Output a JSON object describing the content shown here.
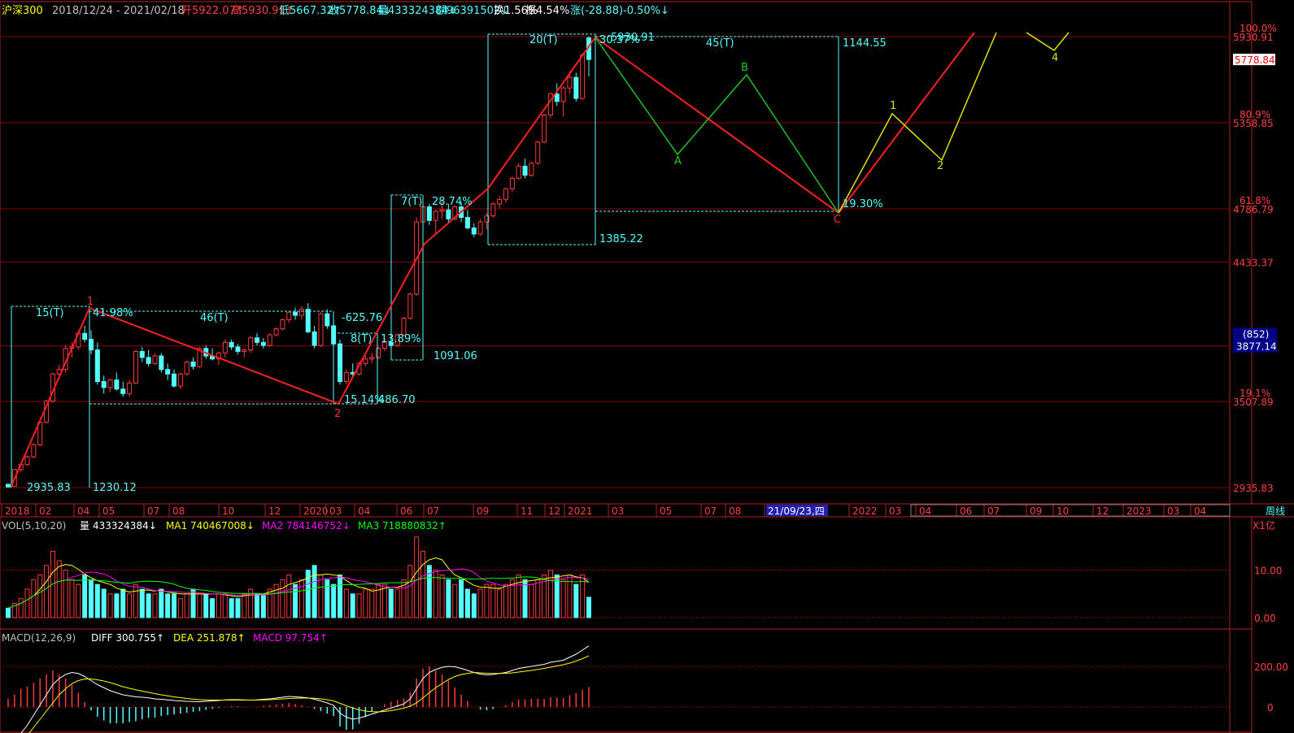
{
  "colors": {
    "up": "#ff3b3b",
    "down": "#54ffff",
    "grid": "#8b0000",
    "axis": "#b22222",
    "ma1": "#ffff00",
    "ma2": "#ff00ff",
    "ma3": "#00ff00",
    "diff": "#ffffff",
    "dea": "#ffff00",
    "cyan": "#54ffff",
    "wave_red": "#ff2020",
    "wave_green": "#20c020",
    "wave_yellow": "#e0e000"
  },
  "header": {
    "name": "沪深300",
    "range": "2018/12/24 - 2021/02/18",
    "items": [
      {
        "text": "开5922.07↑",
        "color": "#ff4040"
      },
      {
        "text": "高5930.91↑",
        "color": "#ff4040"
      },
      {
        "text": "低5667.32↑",
        "color": "#54ffff"
      },
      {
        "text": "收5778.84↓",
        "color": "#54ffff"
      },
      {
        "text": "量433324384↓",
        "color": "#54ffff"
      },
      {
        "text": "额96391502↓",
        "color": "#54ffff"
      },
      {
        "text": "换1.56%",
        "color": "#ffffff"
      },
      {
        "text": "振4.54%",
        "color": "#ffffff"
      },
      {
        "text": "涨(-28.88)-0.50%↓",
        "color": "#54ffff"
      }
    ]
  },
  "price_axis": {
    "labels": [
      {
        "price": 5930.91,
        "text": "5930.91",
        "pct": "100.0%"
      },
      {
        "price": 5358.85,
        "text": "5358.85",
        "pct": "80.9%"
      },
      {
        "price": 4786.79,
        "text": "4786.79",
        "pct": "61.8%"
      },
      {
        "price": 4433.37,
        "text": "4433.37",
        "pct": ""
      },
      {
        "price": 3877.14,
        "text": "3877.14",
        "pct": "38.2%"
      },
      {
        "price": 3507.89,
        "text": "3507.89",
        "pct": "19.1%"
      },
      {
        "price": 2935.83,
        "text": "2935.83",
        "pct": ""
      }
    ],
    "current": "5778.84",
    "current_price": 5778.84,
    "box_label": "(852)",
    "box_value": "3877.14"
  },
  "time_axis": {
    "labels": [
      "2018",
      "02",
      "04",
      "05",
      "07",
      "08",
      "10",
      "12",
      "2020",
      "03",
      "04",
      "06",
      "07",
      "09",
      "11",
      "12",
      "2021",
      "03",
      "05",
      "07",
      "08",
      "21/09/23,四",
      "2022",
      "03",
      "04",
      "06",
      "07",
      "09",
      "10",
      "12",
      "2023",
      "03",
      "04"
    ],
    "tag": "周线"
  },
  "annotations": {
    "texts": [
      "15(T)",
      "41.98%",
      "46(T)",
      "-625.76",
      "1230.12",
      "2935.83",
      "8(T)",
      "13.89%",
      "15.14%",
      "486.70",
      "7(T)",
      "28.74%",
      "1091.06",
      "20(T)",
      "30.37%",
      "5930.91",
      "45(T)",
      "1144.55",
      "1385.22",
      "19.30%"
    ],
    "points": [
      "1",
      "2",
      "A",
      "B",
      "C",
      "1",
      "2",
      "4"
    ]
  },
  "volume": {
    "title": "VOL(5,10,20)",
    "vol_label": "量",
    "vol_value": "433324384↓",
    "ma1": "MA1 740467008↓",
    "ma2": "MA2 784146752↓",
    "ma3": "MA3 718880832↑",
    "unit": "X1亿",
    "axis": [
      "10.00",
      "0.00"
    ]
  },
  "macd": {
    "title": "MACD(12,26,9)",
    "diff": "DIFF 300.755↑",
    "dea": "DEA 251.878↑",
    "macd": "MACD 97.754↑",
    "axis": [
      "200.00",
      "0"
    ]
  },
  "chart_data": {
    "type": "candlestick",
    "interval": "weekly",
    "start": "2018/12/24",
    "end": "2021/02/18",
    "ylim": [
      2935.83,
      5930.91
    ],
    "ohlc_weekly_approx": [
      [
        2958,
        2960,
        2935,
        2940
      ],
      [
        2945,
        3060,
        2945,
        3055
      ],
      [
        3055,
        3100,
        3040,
        3090
      ],
      [
        3090,
        3150,
        3080,
        3140
      ],
      [
        3140,
        3230,
        3130,
        3220
      ],
      [
        3220,
        3380,
        3210,
        3370
      ],
      [
        3370,
        3520,
        3360,
        3510
      ],
      [
        3510,
        3700,
        3500,
        3690
      ],
      [
        3690,
        3750,
        3660,
        3720
      ],
      [
        3720,
        3880,
        3700,
        3860
      ],
      [
        3860,
        3900,
        3800,
        3870
      ],
      [
        3870,
        3980,
        3850,
        3960
      ],
      [
        3960,
        4010,
        3900,
        3920
      ],
      [
        3920,
        3980,
        3820,
        3850
      ],
      [
        3850,
        3900,
        3620,
        3640
      ],
      [
        3640,
        3680,
        3560,
        3600
      ],
      [
        3600,
        3660,
        3570,
        3650
      ],
      [
        3650,
        3700,
        3580,
        3590
      ],
      [
        3590,
        3640,
        3540,
        3560
      ],
      [
        3560,
        3650,
        3540,
        3630
      ],
      [
        3630,
        3850,
        3620,
        3840
      ],
      [
        3840,
        3870,
        3770,
        3800
      ],
      [
        3800,
        3850,
        3740,
        3760
      ],
      [
        3760,
        3830,
        3750,
        3810
      ],
      [
        3810,
        3830,
        3700,
        3720
      ],
      [
        3720,
        3760,
        3650,
        3690
      ],
      [
        3690,
        3720,
        3600,
        3610
      ],
      [
        3610,
        3700,
        3590,
        3690
      ],
      [
        3690,
        3780,
        3680,
        3770
      ],
      [
        3770,
        3800,
        3720,
        3740
      ],
      [
        3740,
        3870,
        3730,
        3860
      ],
      [
        3860,
        3880,
        3790,
        3810
      ],
      [
        3810,
        3860,
        3780,
        3790
      ],
      [
        3790,
        3840,
        3750,
        3830
      ],
      [
        3830,
        3920,
        3800,
        3900
      ],
      [
        3900,
        3920,
        3850,
        3870
      ],
      [
        3870,
        3890,
        3820,
        3840
      ],
      [
        3840,
        3860,
        3800,
        3850
      ],
      [
        3850,
        3940,
        3830,
        3930
      ],
      [
        3930,
        3960,
        3880,
        3900
      ],
      [
        3900,
        3930,
        3860,
        3880
      ],
      [
        3880,
        3960,
        3870,
        3950
      ],
      [
        3950,
        4000,
        3940,
        3990
      ],
      [
        3990,
        4060,
        3980,
        4050
      ],
      [
        4050,
        4110,
        4030,
        4100
      ],
      [
        4100,
        4130,
        4050,
        4080
      ],
      [
        4080,
        4140,
        4050,
        4120
      ],
      [
        4120,
        4160,
        3960,
        3970
      ],
      [
        3970,
        4010,
        3860,
        3880
      ],
      [
        3880,
        4100,
        3870,
        4090
      ],
      [
        4090,
        4120,
        3990,
        4010
      ],
      [
        4010,
        4050,
        3870,
        3890
      ],
      [
        3890,
        3920,
        3620,
        3640
      ],
      [
        3640,
        3720,
        3620,
        3700
      ],
      [
        3700,
        3760,
        3660,
        3690
      ],
      [
        3690,
        3770,
        3680,
        3760
      ],
      [
        3760,
        3810,
        3740,
        3790
      ],
      [
        3790,
        3830,
        3760,
        3800
      ],
      [
        3800,
        3870,
        3790,
        3860
      ],
      [
        3860,
        3930,
        3840,
        3900
      ],
      [
        3900,
        3950,
        3860,
        3880
      ],
      [
        3880,
        3960,
        3870,
        3950
      ],
      [
        3950,
        4070,
        3940,
        4060
      ],
      [
        4060,
        4230,
        4050,
        4220
      ],
      [
        4220,
        4730,
        4210,
        4700
      ],
      [
        4700,
        4830,
        4690,
        4800
      ],
      [
        4800,
        4820,
        4680,
        4710
      ],
      [
        4710,
        4780,
        4620,
        4770
      ],
      [
        4770,
        4850,
        4720,
        4780
      ],
      [
        4780,
        4820,
        4700,
        4720
      ],
      [
        4720,
        4810,
        4710,
        4800
      ],
      [
        4800,
        4830,
        4700,
        4730
      ],
      [
        4730,
        4780,
        4650,
        4660
      ],
      [
        4660,
        4690,
        4600,
        4620
      ],
      [
        4620,
        4720,
        4610,
        4700
      ],
      [
        4700,
        4760,
        4650,
        4740
      ],
      [
        4740,
        4830,
        4730,
        4820
      ],
      [
        4820,
        4870,
        4790,
        4850
      ],
      [
        4850,
        4930,
        4830,
        4920
      ],
      [
        4920,
        5000,
        4900,
        4990
      ],
      [
        4990,
        5090,
        4980,
        5070
      ],
      [
        5070,
        5120,
        4990,
        5010
      ],
      [
        5010,
        5100,
        5000,
        5090
      ],
      [
        5090,
        5240,
        5080,
        5230
      ],
      [
        5230,
        5420,
        5220,
        5410
      ],
      [
        5410,
        5560,
        5390,
        5550
      ],
      [
        5550,
        5620,
        5470,
        5500
      ],
      [
        5500,
        5600,
        5400,
        5590
      ],
      [
        5590,
        5700,
        5550,
        5660
      ],
      [
        5660,
        5690,
        5500,
        5520
      ],
      [
        5520,
        5820,
        5510,
        5810
      ],
      [
        5922,
        5930.91,
        5667.32,
        5778.84
      ]
    ],
    "volume_approx_x1e8": [
      2,
      3,
      4,
      6,
      8,
      9,
      11,
      14,
      12,
      10,
      8,
      7,
      9,
      8,
      7,
      6,
      5,
      5,
      6,
      5,
      7,
      6,
      5,
      5,
      6,
      5,
      5,
      4,
      5,
      6,
      5,
      5,
      4,
      5,
      5,
      4,
      4,
      5,
      6,
      5,
      5,
      6,
      7,
      8,
      9,
      7,
      8,
      10,
      11,
      9,
      8,
      7,
      9,
      6,
      5,
      5,
      6,
      6,
      7,
      7,
      6,
      6,
      8,
      11,
      17,
      14,
      11,
      10,
      9,
      8,
      7,
      8,
      6,
      5,
      6,
      7,
      7,
      6,
      7,
      8,
      9,
      8,
      7,
      8,
      9,
      10,
      9,
      8,
      9,
      7,
      9,
      4.3
    ],
    "macd_approx": {
      "diff": [
        -200,
        -170,
        -130,
        -90,
        -40,
        10,
        60,
        110,
        140,
        160,
        170,
        165,
        150,
        130,
        110,
        95,
        80,
        70,
        60,
        55,
        50,
        48,
        45,
        40,
        38,
        35,
        32,
        30,
        28,
        27,
        26,
        28,
        30,
        32,
        35,
        36,
        36,
        35,
        34,
        35,
        38,
        40,
        44,
        48,
        52,
        50,
        48,
        45,
        38,
        30,
        20,
        8,
        -30,
        -50,
        -60,
        -55,
        -45,
        -35,
        -25,
        -15,
        -5,
        5,
        15,
        40,
        90,
        140,
        170,
        185,
        195,
        200,
        198,
        190,
        180,
        170,
        162,
        158,
        160,
        165,
        170,
        180,
        190,
        195,
        200,
        205,
        210,
        220,
        225,
        230,
        245,
        260,
        280,
        300.755
      ],
      "dea": [
        -220,
        -200,
        -175,
        -140,
        -100,
        -60,
        -20,
        20,
        60,
        90,
        115,
        130,
        138,
        138,
        134,
        128,
        120,
        110,
        100,
        92,
        85,
        78,
        72,
        66,
        60,
        55,
        50,
        46,
        42,
        39,
        36,
        35,
        34,
        34,
        34,
        34,
        34,
        34,
        34,
        34,
        35,
        36,
        38,
        40,
        42,
        43,
        44,
        44,
        43,
        40,
        36,
        30,
        18,
        6,
        -5,
        -14,
        -20,
        -23,
        -24,
        -22,
        -18,
        -12,
        -6,
        4,
        20,
        45,
        70,
        95,
        115,
        135,
        150,
        160,
        165,
        170,
        168,
        166,
        165,
        165,
        166,
        168,
        172,
        176,
        180,
        185,
        190,
        196,
        202,
        208,
        216,
        226,
        238,
        251.878
      ]
    }
  }
}
